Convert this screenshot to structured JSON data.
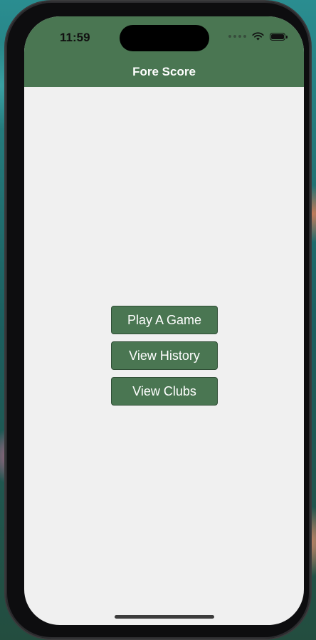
{
  "status_bar": {
    "time": "11:59",
    "icons": [
      "signal-dots-icon",
      "wifi-icon",
      "battery-icon"
    ]
  },
  "nav": {
    "title": "Fore Score"
  },
  "menu": {
    "play_label": "Play A Game",
    "history_label": "View History",
    "clubs_label": "View Clubs"
  },
  "colors": {
    "nav_background": "#4a7652",
    "button_background": "#4a7652",
    "screen_background": "#f0f0f0",
    "text_on_green": "#ffffff"
  }
}
